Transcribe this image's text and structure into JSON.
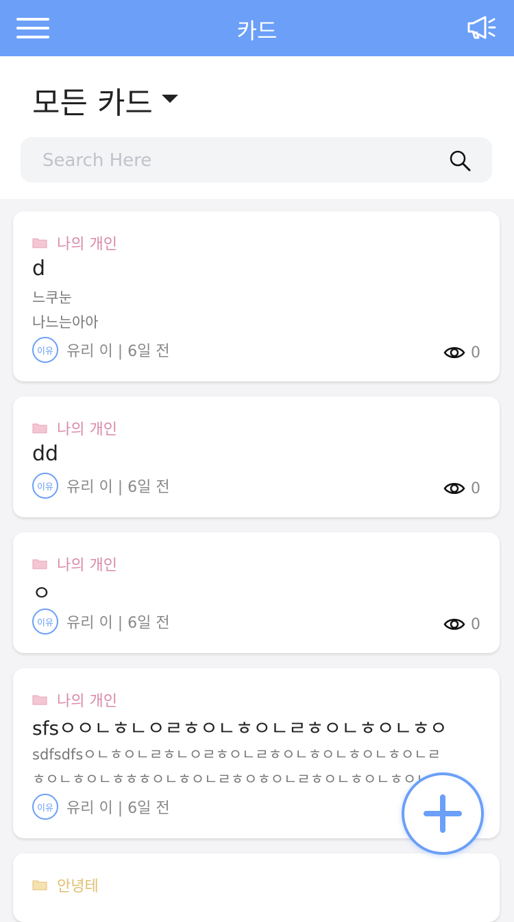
{
  "header": {
    "title": "카드"
  },
  "page_title": "모든 카드",
  "search": {
    "placeholder": "Search Here"
  },
  "cards": [
    {
      "folder": "나의 개인",
      "title": "d",
      "body_lines": [
        "느쿠눈",
        "나느는아아"
      ],
      "avatar": "이유",
      "meta": "유리 이  | 6일 전",
      "views": "0"
    },
    {
      "folder": "나의 개인",
      "title": "dd",
      "body_lines": [],
      "avatar": "이유",
      "meta": "유리 이  | 6일 전",
      "views": "0"
    },
    {
      "folder": "나의 개인",
      "title": "ㅇ",
      "body_lines": [],
      "avatar": "이유",
      "meta": "유리 이  | 6일 전",
      "views": "0"
    },
    {
      "folder": "나의 개인",
      "title": "sfsㅇㅇㄴㅎㄴㅇㄹㅎㅇㄴㅎㅇㄴㄹㅎㅇㄴㅎㅇㄴㅎㅇ",
      "body_lines": [
        "sdfsdfsㅇㄴㅎㅇㄴㄹㅎㄴㅇㄹㅎㅇㄴㄹㅎㅇㄴㅎㅇㄴㅎㅇㄴㅎㅇㄴㄹ",
        "ㅎㅇㄴㅎㅇㄴㅎㅎㅎㅇㄴㅎㅇㄴㄹㅎㅇㅎㅇㄴㄹㅎㅇㄴㅎㅇㄴㅎㅇㄴㅎ"
      ],
      "avatar": "이유",
      "meta": "유리 이  | 6일 전",
      "views": ""
    },
    {
      "folder": "안녕테",
      "title": "",
      "body_lines": [],
      "avatar": "",
      "meta": "",
      "views": ""
    }
  ],
  "colors": {
    "header": "#6b9ff8",
    "accent": "#6b9ff8",
    "folder_pink": "#d98aa8",
    "folder_yellow": "#e0c070"
  }
}
